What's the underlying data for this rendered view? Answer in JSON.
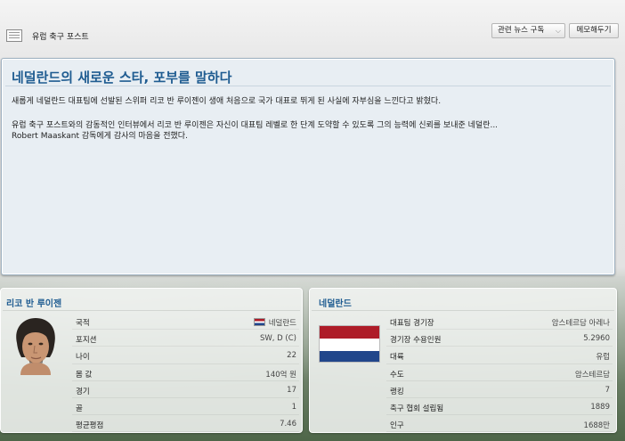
{
  "header": {
    "source": "유럽 축구 포스트",
    "related_news_button": "관련 뉴스 구독",
    "memo_button": "메모해두기"
  },
  "article": {
    "title": "네덜란드의 새로운 스타, 포부를 말하다",
    "paragraph1": "새롭게 네덜란드 대표팀에 선발된 스위퍼 리코 반 루이젠이 생애 처음으로 국가 대표로 뛰게 된 사실에 자부심을 느낀다고 밝혔다.",
    "paragraph2_line1": "유럽 축구 포스트와의 감동적인 인터뷰에서 리코 반 루이젠은 자신이 대표팀 레벨로 한 단계 도약할 수 있도록 그의 능력에 신뢰를 보내준 네덜란...",
    "paragraph2_line2": "Robert Maaskant 감독에게 감사의 마음을 전했다."
  },
  "player": {
    "name": "리코 반 루이젠",
    "rows": [
      {
        "label": "국적",
        "value": "네덜란드"
      },
      {
        "label": "포지션",
        "value": "SW, D (C)"
      },
      {
        "label": "나이",
        "value": "22"
      },
      {
        "label": "몸 값",
        "value": "140억 원"
      },
      {
        "label": "경기",
        "value": "17"
      },
      {
        "label": "골",
        "value": "1"
      },
      {
        "label": "평균평점",
        "value": "7.46"
      }
    ]
  },
  "country": {
    "name": "네덜란드",
    "rows": [
      {
        "label": "대표팀 경기장",
        "value": "암스테르담 아레나"
      },
      {
        "label": "경기장 수용인원",
        "value": "5.2960"
      },
      {
        "label": "대륙",
        "value": "유럽"
      },
      {
        "label": "수도",
        "value": "암스테르담"
      },
      {
        "label": "랭킹",
        "value": "7"
      },
      {
        "label": "축구 협회 설립됨",
        "value": "1889"
      },
      {
        "label": "인구",
        "value": "1688만"
      }
    ]
  },
  "colors": {
    "title_blue": "#1f5c91",
    "flag_red": "#ae1c28",
    "flag_white": "#ffffff",
    "flag_blue": "#21468b"
  },
  "icons": {
    "source": "newspaper-icon",
    "dropdown": "chevron-down-icon",
    "nationality": "netherlands-flag-icon"
  }
}
